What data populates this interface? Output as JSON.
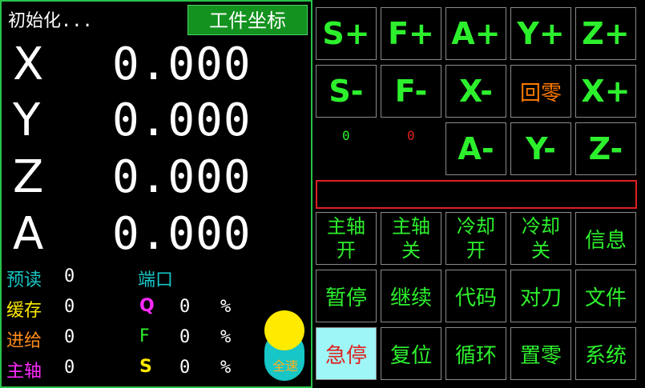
{
  "status": "初始化...",
  "coord_mode_button": "工件坐标",
  "axes": [
    {
      "label": "X",
      "value": "0.000"
    },
    {
      "label": "Y",
      "value": "0.000"
    },
    {
      "label": "Z",
      "value": "0.000"
    },
    {
      "label": "A",
      "value": "0.000"
    }
  ],
  "info": {
    "preread_label": "预读",
    "preread_value": "0",
    "buffer_label": "缓存",
    "buffer_value": "0",
    "feed_label": "进给",
    "feed_value": "0",
    "spindle_label": "主轴",
    "spindle_value": "0",
    "port_label": "端口",
    "q_label": "Q",
    "q_value": "0",
    "q_unit": "%",
    "f_label": "F",
    "f_value": "0",
    "f_unit": "%",
    "s_label": "S",
    "s_value": "0",
    "s_unit": "%"
  },
  "override_knob_label": "全速",
  "buttons": {
    "s_plus": "S+",
    "f_plus": "F+",
    "a_plus": "A+",
    "y_plus": "Y+",
    "z_plus": "Z+",
    "s_minus": "S-",
    "f_minus": "F-",
    "x_minus": "X-",
    "home": "回零",
    "x_plus": "X+",
    "a_minus": "A-",
    "y_minus": "Y-",
    "z_minus": "Z-",
    "spindle_on_1": "主轴",
    "spindle_on_2": "开",
    "spindle_off_1": "主轴",
    "spindle_off_2": "关",
    "coolant_on_1": "冷却",
    "coolant_on_2": "开",
    "coolant_off_1": "冷却",
    "coolant_off_2": "关",
    "info": "信息",
    "pause": "暂停",
    "resume": "继续",
    "code": "代码",
    "tool_set": "对刀",
    "file": "文件",
    "estop": "急停",
    "reset": "复位",
    "cycle": "循环",
    "zero": "置零",
    "system": "系统"
  },
  "counters": {
    "s_counter": "0",
    "f_counter": "0"
  },
  "message": "",
  "colors": {
    "green": "#2df02d",
    "cyan": "#17c6c6",
    "yellow": "#ffea00",
    "orange": "#ffb020",
    "magenta": "#ff2bff",
    "estop_bg": "#9ff6f6",
    "estop_text": "#e02020",
    "home_text": "#ff7a00"
  }
}
